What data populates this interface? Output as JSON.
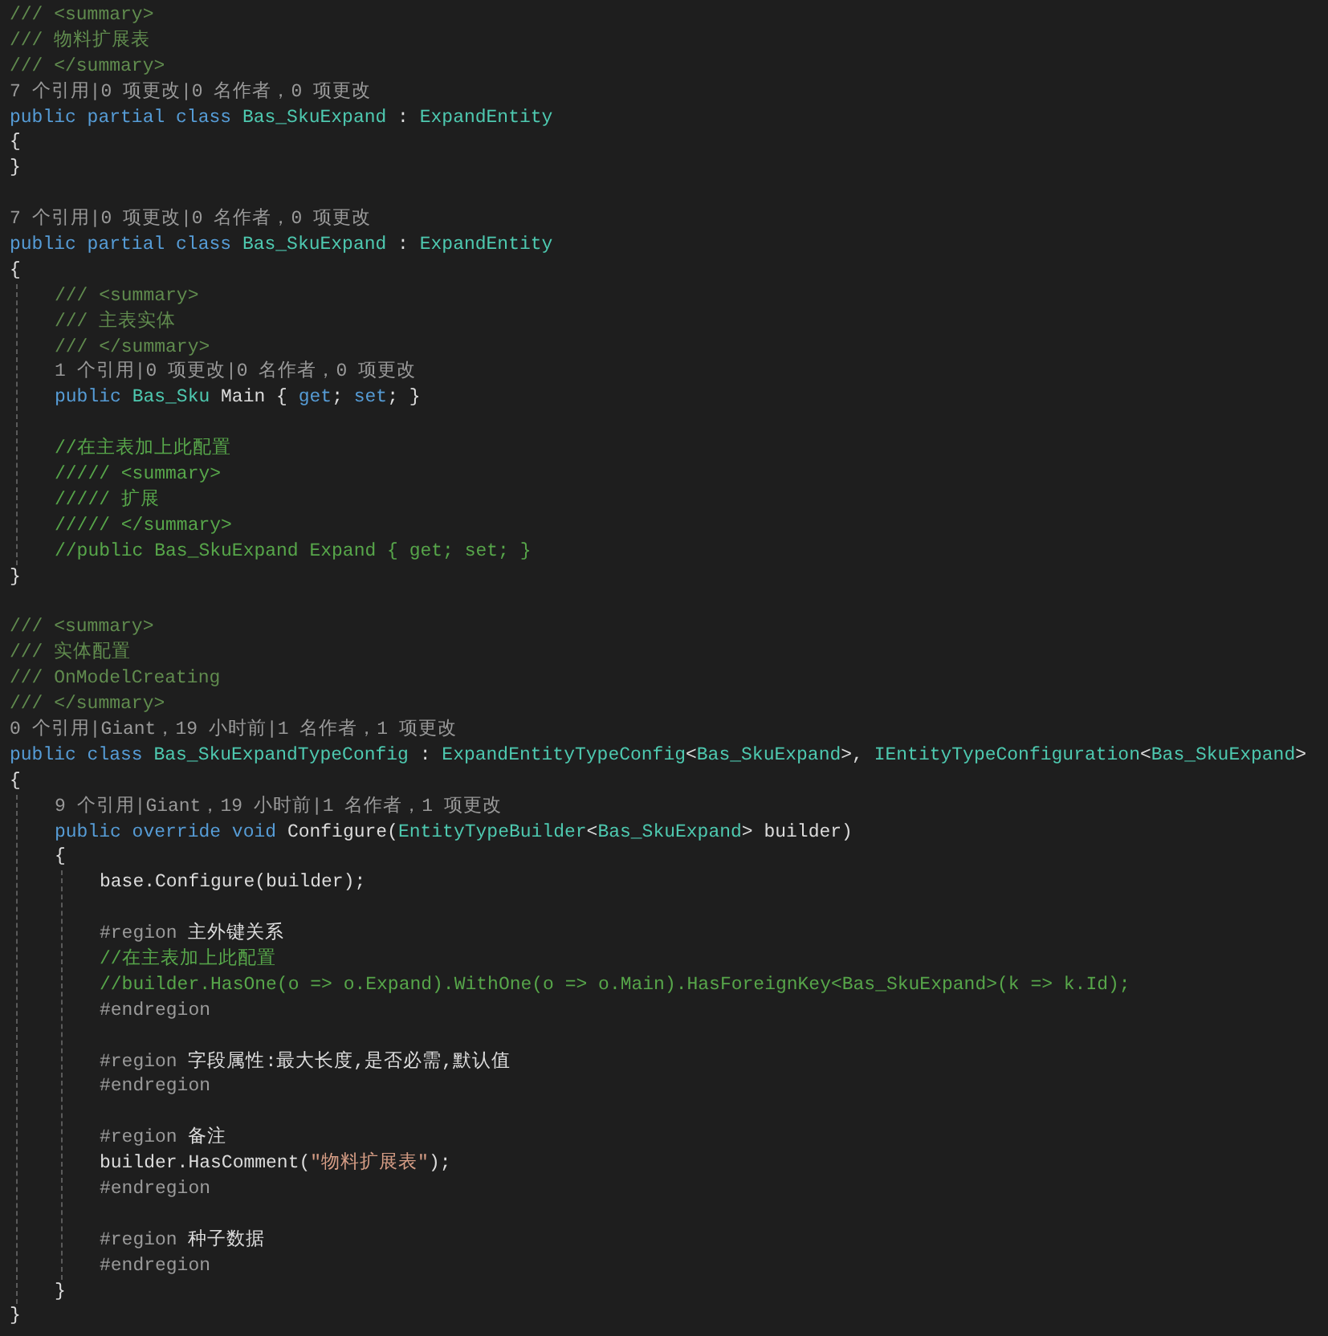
{
  "editor": {
    "lines": [
      {
        "kind": "doc",
        "tokens": [
          {
            "text": "/// <summary>",
            "kind": "doc"
          }
        ]
      },
      {
        "kind": "doc",
        "tokens": [
          {
            "text": "/// 物料扩展表",
            "kind": "doc"
          }
        ]
      },
      {
        "kind": "doc",
        "tokens": [
          {
            "text": "/// </summary>",
            "kind": "doc"
          }
        ]
      },
      {
        "kind": "codelens",
        "tokens": [
          {
            "text": "7 个引用|0 项更改|0 名作者，0 项更改",
            "kind": "codelens"
          }
        ]
      },
      {
        "kind": "code",
        "tokens": [
          {
            "text": "public partial class ",
            "kind": "keyword"
          },
          {
            "text": "Bas_SkuExpand",
            "kind": "type"
          },
          {
            "text": " : ",
            "kind": "plain"
          },
          {
            "text": "ExpandEntity",
            "kind": "type"
          }
        ]
      },
      {
        "kind": "code",
        "tokens": [
          {
            "text": "{",
            "kind": "plain"
          }
        ]
      },
      {
        "kind": "code",
        "tokens": [
          {
            "text": "}",
            "kind": "plain"
          }
        ]
      },
      {
        "kind": "blank"
      },
      {
        "kind": "codelens",
        "tokens": [
          {
            "text": "7 个引用|0 项更改|0 名作者，0 项更改",
            "kind": "codelens"
          }
        ]
      },
      {
        "kind": "code",
        "tokens": [
          {
            "text": "public partial class ",
            "kind": "keyword"
          },
          {
            "text": "Bas_SkuExpand",
            "kind": "type"
          },
          {
            "text": " : ",
            "kind": "plain"
          },
          {
            "text": "ExpandEntity",
            "kind": "type"
          }
        ]
      },
      {
        "kind": "code",
        "tokens": [
          {
            "text": "{",
            "kind": "plain"
          }
        ]
      },
      {
        "kind": "block",
        "children": [
          {
            "kind": "doc",
            "tokens": [
              {
                "text": "/// <summary>",
                "kind": "doc"
              }
            ]
          },
          {
            "kind": "doc",
            "tokens": [
              {
                "text": "/// 主表实体",
                "kind": "doc"
              }
            ]
          },
          {
            "kind": "doc",
            "tokens": [
              {
                "text": "/// </summary>",
                "kind": "doc"
              }
            ]
          },
          {
            "kind": "codelens",
            "tokens": [
              {
                "text": "1 个引用|0 项更改|0 名作者，0 项更改",
                "kind": "codelens"
              }
            ]
          },
          {
            "kind": "code",
            "tokens": [
              {
                "text": "public ",
                "kind": "keyword"
              },
              {
                "text": "Bas_Sku",
                "kind": "type"
              },
              {
                "text": " Main { ",
                "kind": "plain"
              },
              {
                "text": "get",
                "kind": "keyword"
              },
              {
                "text": "; ",
                "kind": "plain"
              },
              {
                "text": "set",
                "kind": "keyword"
              },
              {
                "text": "; }",
                "kind": "plain"
              }
            ]
          },
          {
            "kind": "blank"
          },
          {
            "kind": "comment",
            "tokens": [
              {
                "text": "//在主表加上此配置",
                "kind": "comment"
              }
            ]
          },
          {
            "kind": "comment",
            "tokens": [
              {
                "text": "///// <summary>",
                "kind": "comment"
              }
            ]
          },
          {
            "kind": "comment",
            "tokens": [
              {
                "text": "///// 扩展",
                "kind": "comment"
              }
            ]
          },
          {
            "kind": "comment",
            "tokens": [
              {
                "text": "///// </summary>",
                "kind": "comment"
              }
            ]
          },
          {
            "kind": "comment",
            "tokens": [
              {
                "text": "//public Bas_SkuExpand Expand { get; set; }",
                "kind": "comment"
              }
            ]
          }
        ]
      },
      {
        "kind": "code",
        "tokens": [
          {
            "text": "}",
            "kind": "plain"
          }
        ]
      },
      {
        "kind": "blank"
      },
      {
        "kind": "doc",
        "tokens": [
          {
            "text": "/// <summary>",
            "kind": "doc"
          }
        ]
      },
      {
        "kind": "doc",
        "tokens": [
          {
            "text": "/// 实体配置",
            "kind": "doc"
          }
        ]
      },
      {
        "kind": "doc",
        "tokens": [
          {
            "text": "/// OnModelCreating",
            "kind": "doc"
          }
        ]
      },
      {
        "kind": "doc",
        "tokens": [
          {
            "text": "/// </summary>",
            "kind": "doc"
          }
        ]
      },
      {
        "kind": "codelens",
        "tokens": [
          {
            "text": "0 个引用|Giant，19 小时前|1 名作者，1 项更改",
            "kind": "codelens"
          }
        ]
      },
      {
        "kind": "code",
        "tokens": [
          {
            "text": "public class ",
            "kind": "keyword"
          },
          {
            "text": "Bas_SkuExpandTypeConfig",
            "kind": "type"
          },
          {
            "text": " : ",
            "kind": "plain"
          },
          {
            "text": "ExpandEntityTypeConfig",
            "kind": "type"
          },
          {
            "text": "<",
            "kind": "plain"
          },
          {
            "text": "Bas_SkuExpand",
            "kind": "type"
          },
          {
            "text": ">, ",
            "kind": "plain"
          },
          {
            "text": "IEntityTypeConfiguration",
            "kind": "type"
          },
          {
            "text": "<",
            "kind": "plain"
          },
          {
            "text": "Bas_SkuExpand",
            "kind": "type"
          },
          {
            "text": ">",
            "kind": "plain"
          }
        ]
      },
      {
        "kind": "code",
        "tokens": [
          {
            "text": "{",
            "kind": "plain"
          }
        ]
      },
      {
        "kind": "block",
        "children": [
          {
            "kind": "codelens",
            "tokens": [
              {
                "text": "9 个引用|Giant，19 小时前|1 名作者，1 项更改",
                "kind": "codelens"
              }
            ]
          },
          {
            "kind": "code",
            "tokens": [
              {
                "text": "public override void ",
                "kind": "keyword"
              },
              {
                "text": "Configure(",
                "kind": "plain"
              },
              {
                "text": "EntityTypeBuilder",
                "kind": "type"
              },
              {
                "text": "<",
                "kind": "plain"
              },
              {
                "text": "Bas_SkuExpand",
                "kind": "type"
              },
              {
                "text": "> builder)",
                "kind": "plain"
              }
            ]
          },
          {
            "kind": "code",
            "tokens": [
              {
                "text": "{",
                "kind": "plain"
              }
            ]
          },
          {
            "kind": "block",
            "children": [
              {
                "kind": "code",
                "tokens": [
                  {
                    "text": "base.Configure(builder);",
                    "kind": "plain"
                  }
                ]
              },
              {
                "kind": "blank"
              },
              {
                "kind": "region",
                "tokens": [
                  {
                    "text": "#region",
                    "kind": "preproc"
                  },
                  {
                    "text": " 主外键关系",
                    "kind": "plain"
                  }
                ]
              },
              {
                "kind": "comment",
                "tokens": [
                  {
                    "text": "//在主表加上此配置",
                    "kind": "comment"
                  }
                ]
              },
              {
                "kind": "comment",
                "tokens": [
                  {
                    "text": "//builder.HasOne(o => o.Expand).WithOne(o => o.Main).HasForeignKey<Bas_SkuExpand>(k => k.Id);",
                    "kind": "comment"
                  }
                ]
              },
              {
                "kind": "region",
                "tokens": [
                  {
                    "text": "#endregion",
                    "kind": "preproc"
                  }
                ]
              },
              {
                "kind": "blank"
              },
              {
                "kind": "region",
                "tokens": [
                  {
                    "text": "#region",
                    "kind": "preproc"
                  },
                  {
                    "text": " 字段属性:最大长度,是否必需,默认值",
                    "kind": "plain"
                  }
                ]
              },
              {
                "kind": "region",
                "tokens": [
                  {
                    "text": "#endregion",
                    "kind": "preproc"
                  }
                ]
              },
              {
                "kind": "blank"
              },
              {
                "kind": "region",
                "tokens": [
                  {
                    "text": "#region",
                    "kind": "preproc"
                  },
                  {
                    "text": " 备注",
                    "kind": "plain"
                  }
                ]
              },
              {
                "kind": "code",
                "tokens": [
                  {
                    "text": "builder.HasComment(",
                    "kind": "plain"
                  },
                  {
                    "text": "\"物料扩展表\"",
                    "kind": "string"
                  },
                  {
                    "text": ");",
                    "kind": "plain"
                  }
                ]
              },
              {
                "kind": "region",
                "tokens": [
                  {
                    "text": "#endregion",
                    "kind": "preproc"
                  }
                ]
              },
              {
                "kind": "blank"
              },
              {
                "kind": "region",
                "tokens": [
                  {
                    "text": "#region",
                    "kind": "preproc"
                  },
                  {
                    "text": " 种子数据",
                    "kind": "plain"
                  }
                ]
              },
              {
                "kind": "region",
                "tokens": [
                  {
                    "text": "#endregion",
                    "kind": "preproc"
                  }
                ]
              }
            ]
          },
          {
            "kind": "code",
            "tokens": [
              {
                "text": "}",
                "kind": "plain"
              }
            ]
          }
        ]
      },
      {
        "kind": "code",
        "tokens": [
          {
            "text": "}",
            "kind": "plain"
          }
        ]
      }
    ]
  }
}
